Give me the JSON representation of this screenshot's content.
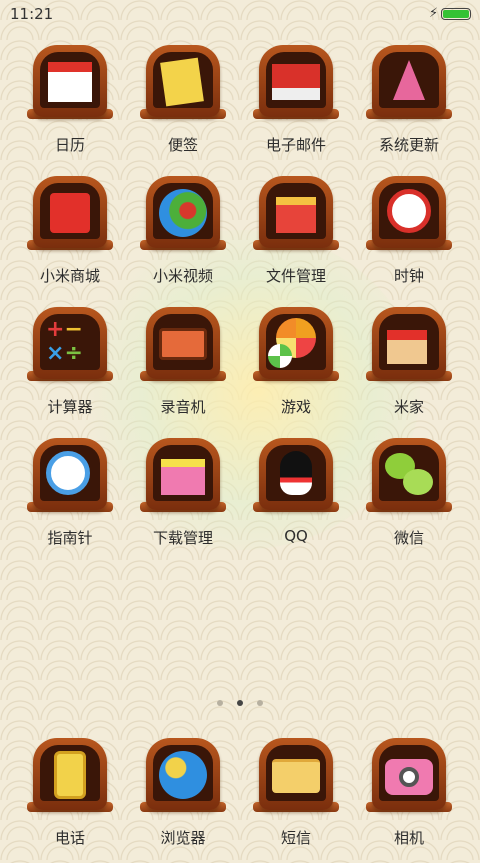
{
  "status": {
    "time": "11:21",
    "battery_level": 1.0
  },
  "apps": [
    {
      "label": "日历",
      "icon": "calendar-icon"
    },
    {
      "label": "便签",
      "icon": "notes-icon"
    },
    {
      "label": "电子邮件",
      "icon": "email-icon"
    },
    {
      "label": "系统更新",
      "icon": "system-update-icon"
    },
    {
      "label": "小米商城",
      "icon": "mi-store-icon"
    },
    {
      "label": "小米视频",
      "icon": "mi-video-icon"
    },
    {
      "label": "文件管理",
      "icon": "file-manager-icon"
    },
    {
      "label": "时钟",
      "icon": "clock-icon"
    },
    {
      "label": "计算器",
      "icon": "calculator-icon"
    },
    {
      "label": "录音机",
      "icon": "recorder-icon"
    },
    {
      "label": "游戏",
      "icon": "games-icon"
    },
    {
      "label": "米家",
      "icon": "mi-home-icon"
    },
    {
      "label": "指南针",
      "icon": "compass-icon"
    },
    {
      "label": "下载管理",
      "icon": "downloads-icon"
    },
    {
      "label": "QQ",
      "icon": "qq-icon"
    },
    {
      "label": "微信",
      "icon": "wechat-icon"
    }
  ],
  "dock": [
    {
      "label": "电话",
      "icon": "phone-icon"
    },
    {
      "label": "浏览器",
      "icon": "browser-icon"
    },
    {
      "label": "短信",
      "icon": "messages-icon"
    },
    {
      "label": "相机",
      "icon": "camera-icon"
    }
  ],
  "pager": {
    "count": 3,
    "active_index": 1
  },
  "colors": {
    "wood": "#9a4216",
    "wood_dark": "#3a1608",
    "background": "#f3ecd9"
  }
}
